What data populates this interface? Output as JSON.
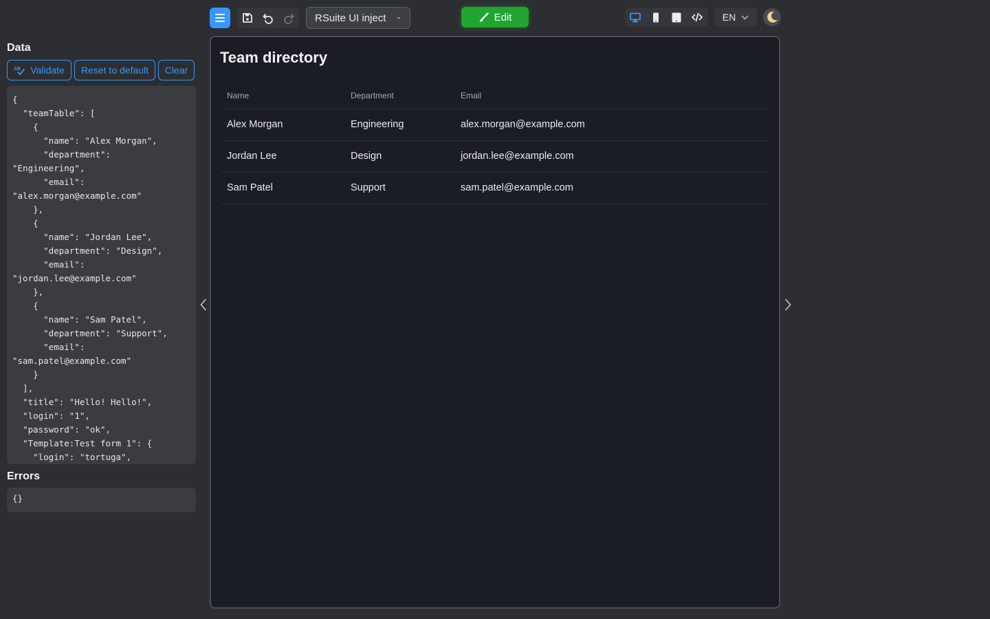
{
  "toolbar": {
    "project_select": "RSuite UI inject",
    "edit_label": "Edit",
    "language": "EN"
  },
  "left_panel": {
    "data_heading": "Data",
    "validate_label": "Validate",
    "reset_label": "Reset to default",
    "clear_label": "Clear",
    "json_text": "{\n  \"teamTable\": [\n    {\n      \"name\": \"Alex Morgan\",\n      \"department\":\n\"Engineering\",\n      \"email\":\n\"alex.morgan@example.com\"\n    },\n    {\n      \"name\": \"Jordan Lee\",\n      \"department\": \"Design\",\n      \"email\":\n\"jordan.lee@example.com\"\n    },\n    {\n      \"name\": \"Sam Patel\",\n      \"department\": \"Support\",\n      \"email\":\n\"sam.patel@example.com\"\n    }\n  ],\n  \"title\": \"Hello! Hello!\",\n  \"login\": \"1\",\n  \"password\": \"ok\",\n  \"Template:Test form 1\": {\n    \"login\": \"tortuga\",",
    "errors_heading": "Errors",
    "errors_text": "{}"
  },
  "canvas": {
    "title": "Team directory",
    "columns": [
      "Name",
      "Department",
      "Email"
    ],
    "rows": [
      [
        "Alex Morgan",
        "Engineering",
        "alex.morgan@example.com"
      ],
      [
        "Jordan Lee",
        "Design",
        "jordan.lee@example.com"
      ],
      [
        "Sam Patel",
        "Support",
        "sam.patel@example.com"
      ]
    ]
  },
  "colors": {
    "accent": "#3498ff",
    "edit_green": "#20a530",
    "background": "#2d2e31",
    "canvas_bg": "#1a1d24"
  },
  "icons": [
    "menu-icon",
    "save-icon",
    "undo-icon",
    "redo-icon",
    "chevron-down-icon",
    "brush-icon",
    "desktop-icon",
    "mobile-icon",
    "tablet-icon",
    "code-icon",
    "moon-icon",
    "validate-icon",
    "chevron-left-icon",
    "chevron-right-icon"
  ]
}
